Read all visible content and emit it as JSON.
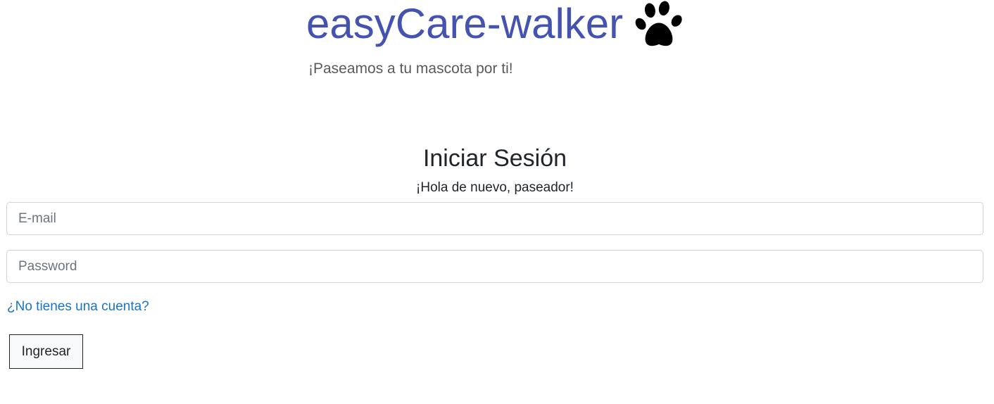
{
  "brand": {
    "name": "easyCare-walker",
    "tagline": "¡Paseamos a tu mascota por ti!",
    "logo_icon": "paw-print-icon",
    "brand_color": "#4452b0"
  },
  "login": {
    "title": "Iniciar Sesión",
    "subtitle": "¡Hola de nuevo, paseador!",
    "email": {
      "placeholder": "E-mail",
      "value": ""
    },
    "password": {
      "placeholder": "Password",
      "value": ""
    },
    "signup_link": "¿No tienes una cuenta?",
    "submit_label": "Ingresar",
    "link_color": "#1a73c9"
  }
}
